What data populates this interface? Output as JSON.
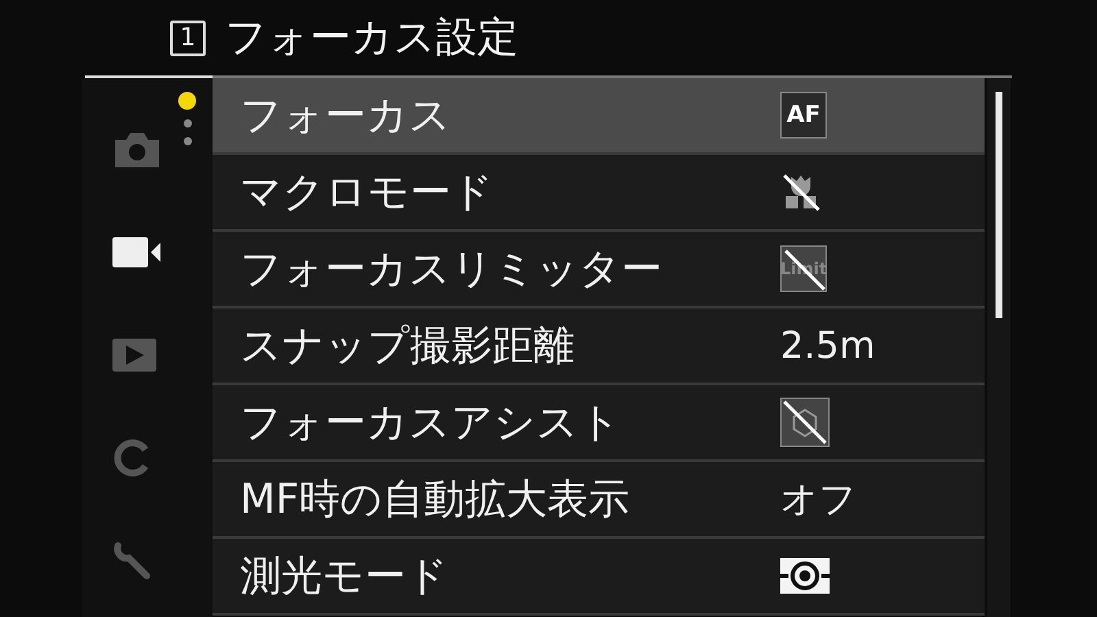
{
  "header": {
    "page_number": "1",
    "title": "フォーカス設定"
  },
  "sidebar": {
    "tabs": [
      {
        "selected": false
      },
      {
        "selected": true
      },
      {
        "selected": false
      },
      {
        "selected": false
      },
      {
        "selected": false
      }
    ],
    "pages": [
      {
        "selected": true
      },
      {
        "selected": false
      },
      {
        "selected": false
      }
    ]
  },
  "menu": {
    "rows": [
      {
        "label": "フォーカス",
        "selected": true,
        "value": {
          "kind": "badge",
          "text": "AF"
        }
      },
      {
        "label": "マクロモード",
        "selected": false,
        "value": {
          "kind": "macro-off"
        }
      },
      {
        "label": "フォーカスリミッター",
        "selected": false,
        "value": {
          "kind": "limit-off",
          "text": "Limit"
        }
      },
      {
        "label": "スナップ撮影距離",
        "selected": false,
        "value": {
          "kind": "text",
          "text": "2.5m"
        }
      },
      {
        "label": "フォーカスアシスト",
        "selected": false,
        "value": {
          "kind": "assist-off"
        }
      },
      {
        "label": "MF時の自動拡大表示",
        "selected": false,
        "value": {
          "kind": "text",
          "text": "オフ"
        }
      },
      {
        "label": "測光モード",
        "selected": false,
        "value": {
          "kind": "metering"
        }
      }
    ]
  }
}
